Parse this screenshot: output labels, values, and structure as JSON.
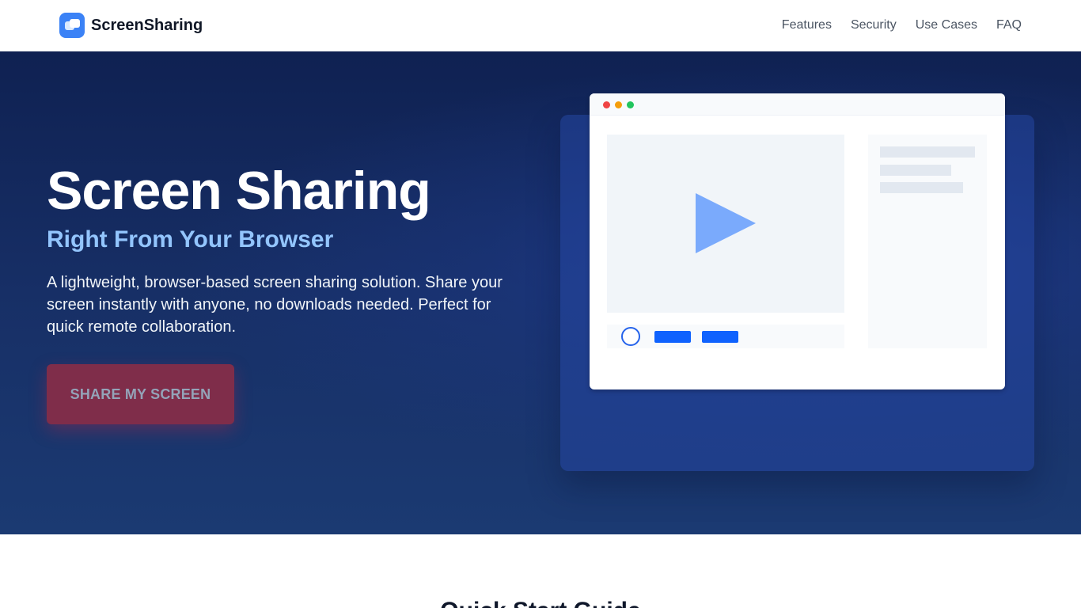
{
  "header": {
    "brand": "ScreenSharing",
    "brand_icon": "screens-icon",
    "nav": [
      {
        "label": "Features"
      },
      {
        "label": "Security"
      },
      {
        "label": "Use Cases"
      },
      {
        "label": "FAQ"
      }
    ]
  },
  "hero": {
    "title": "Screen Sharing",
    "subtitle": "Right From Your Browser",
    "description": "A lightweight, browser-based screen sharing solution. Share your screen instantly with anyone, no downloads needed. Perfect for quick remote collaboration.",
    "cta_label": "SHARE MY SCREEN"
  },
  "mockup": {
    "play_icon": "play-icon",
    "window_dots": [
      "#ef4444",
      "#f59e0b",
      "#22c55e"
    ]
  },
  "next_section": {
    "title": "Quick Start Guide"
  },
  "colors": {
    "accent": "#3b82f6",
    "hero_bg": "#172f66",
    "subtitle": "#93c5fd",
    "cta_bg": "#7f2d4a",
    "control_blue": "#0f62fe"
  }
}
